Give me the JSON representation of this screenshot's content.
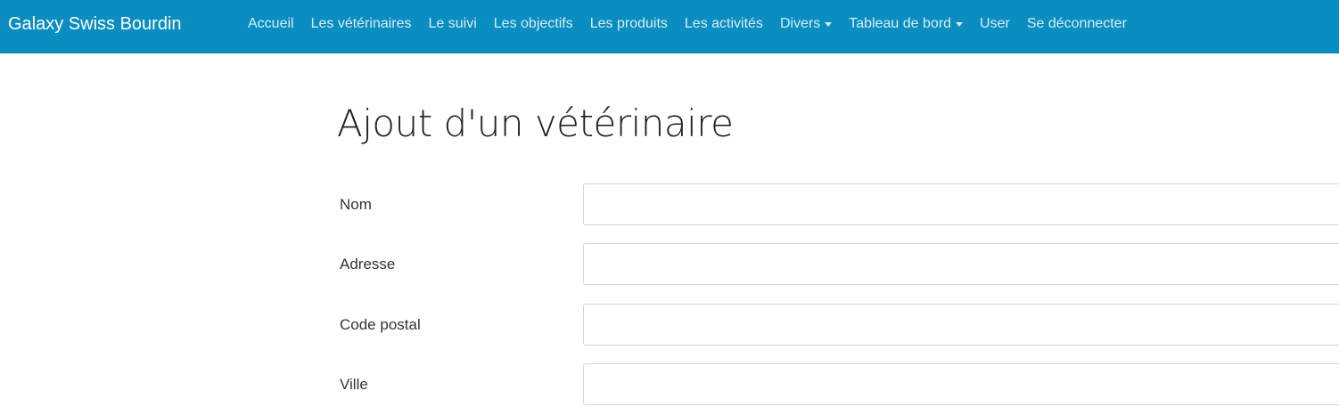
{
  "navbar": {
    "brand": "Galaxy Swiss Bourdin",
    "items": [
      {
        "label": "Accueil",
        "dropdown": false
      },
      {
        "label": "Les vétérinaires",
        "dropdown": false
      },
      {
        "label": "Le suivi",
        "dropdown": false
      },
      {
        "label": "Les objectifs",
        "dropdown": false
      },
      {
        "label": "Les produits",
        "dropdown": false
      },
      {
        "label": "Les activités",
        "dropdown": false
      },
      {
        "label": "Divers",
        "dropdown": true
      },
      {
        "label": "Tableau de bord",
        "dropdown": true
      },
      {
        "label": "User",
        "dropdown": false
      },
      {
        "label": "Se déconnecter",
        "dropdown": false
      }
    ],
    "background_color": "#0a8dc0"
  },
  "page": {
    "title": "Ajout d'un vétérinaire"
  },
  "form": {
    "fields": [
      {
        "label": "Nom",
        "value": "",
        "placeholder": ""
      },
      {
        "label": "Adresse",
        "value": "",
        "placeholder": ""
      },
      {
        "label": "Code postal",
        "value": "",
        "placeholder": ""
      },
      {
        "label": "Ville",
        "value": "",
        "placeholder": ""
      }
    ]
  }
}
